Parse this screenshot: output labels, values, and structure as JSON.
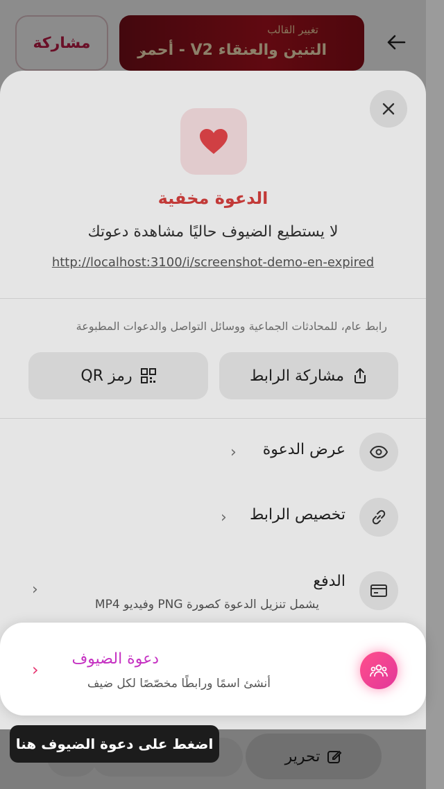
{
  "topbar": {
    "template_sublabel": "تغيير القالب",
    "template_name": "التنين والعنقاء V2 - أحمر",
    "share_label": "مشاركة"
  },
  "sheet": {
    "status_title": "الدعوة مخفية",
    "status_desc": "لا يستطيع الضيوف حاليًا مشاهدة دعوتك",
    "url": "http://localhost:3100/i/screenshot-demo-en-expired",
    "public_note": "رابط عام، للمحادثات الجماعية ووسائل التواصل والدعوات المطبوعة",
    "share_link_label": "مشاركة الرابط",
    "qr_label": "رمز QR",
    "rows": {
      "view": "عرض الدعوة",
      "custom": "تخصيص الرابط",
      "pay_title": "الدفع",
      "pay_sub": "يشمل تنزيل الدعوة كصورة PNG وفيديو MP4"
    },
    "guest": {
      "title": "دعوة الضيوف",
      "subtitle": "أنشئ اسمًا ورابطًا مخصّصًا لكل ضيف"
    }
  },
  "bottom": {
    "edit_label": "تحرير"
  },
  "tooltip": "اضغط على دعوة الضيوف هنا",
  "colors": {
    "accent": "#c21d48",
    "guest_accent": "#c531c2",
    "hidden_title": "#d9413f"
  }
}
